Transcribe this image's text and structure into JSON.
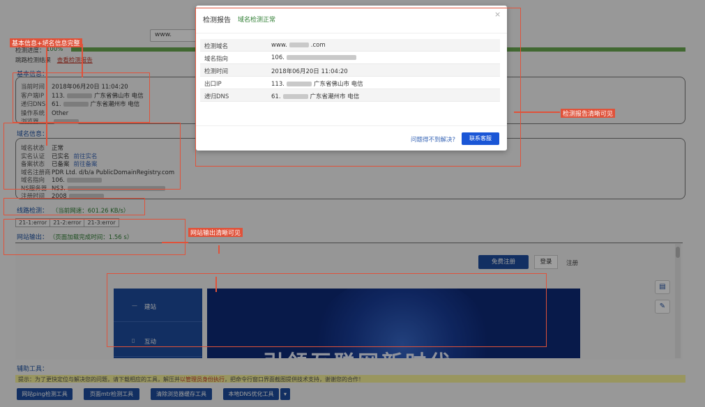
{
  "top_input": {
    "value": "www."
  },
  "progress": {
    "label": "检测进度：",
    "percent_text": "100%",
    "fraction": 1.0
  },
  "detect_result": {
    "label": "跳路检测结果",
    "link": "查看检测报告"
  },
  "basic_info": {
    "title": "基本信息：",
    "lines": [
      {
        "k": "当前时间",
        "v": "2018年06月20日 11:04:20",
        "extra": ""
      },
      {
        "k": "客户端IP",
        "v": "113.",
        "extra": "广东省佛山市 电信"
      },
      {
        "k": "递归DNS",
        "v": "61.",
        "extra": "广东省潮州市 电信"
      },
      {
        "k": "操作系统",
        "v": "Other",
        "extra": ""
      },
      {
        "k": "浏览器",
        "v": "",
        "extra": ""
      }
    ]
  },
  "domain_info": {
    "title": "域名信息：",
    "lines": [
      {
        "k": "域名状态",
        "v": "正常",
        "link": ""
      },
      {
        "k": "实名认证",
        "v": "已实名",
        "link": "前往实名"
      },
      {
        "k": "备案状态",
        "v": "已备案",
        "link": "前往备案"
      },
      {
        "k": "域名注册商",
        "v": "PDR Ltd. d/b/a PublicDomainRegistry.com",
        "link": ""
      },
      {
        "k": "域名指向",
        "v": "106.",
        "link": ""
      },
      {
        "k": "NS服务器",
        "v": "NS3.",
        "link": ""
      },
      {
        "k": "注册时间",
        "v": "2008",
        "link": ""
      }
    ]
  },
  "speed": {
    "title": "线路检测：",
    "sub": "（当前网速：601.26 KB/s）"
  },
  "errors": [
    "21-1:error",
    "21-2:error",
    "21-3:error"
  ],
  "site_output": {
    "title": "网站输出：",
    "sub": "（页面加载完成时间：1.56 s）"
  },
  "frame": {
    "btn_primary": "免费注册",
    "btn_secondary": "登录",
    "text": "注册",
    "side_items": [
      {
        "icon": "—",
        "label": "建站"
      },
      {
        "icon": "▯",
        "label": "互动"
      }
    ],
    "hero_text": "引领互联网新时代",
    "float_icons": [
      "chat-icon",
      "edit-icon"
    ]
  },
  "aux": {
    "title": "辅助工具：",
    "notice_a": "提示：为了更快定位与解决您的问题，请下载相应的工具，解压并",
    "notice_red": "以管理员身份执行",
    "notice_b": "，把命令行窗口界面截图提供技术支持，谢谢您的合作！",
    "buttons": [
      "网站ping检测工具",
      "页面mtr检测工具",
      "清除浏览器缓存工具",
      "本地DNS优化工具"
    ]
  },
  "modal": {
    "title": "检测报告",
    "subtitle": "域名检测正常",
    "close": "×",
    "rows": [
      {
        "k": "检测域名",
        "v": "www.",
        "v2": ".com"
      },
      {
        "k": "域名指向",
        "v": "106.",
        "v2": ""
      },
      {
        "k": "检测时间",
        "v": "2018年06月20日 11:04:20",
        "v2": ""
      },
      {
        "k": "出口IP",
        "v": "113.",
        "v2": "广东省佛山市 电信"
      },
      {
        "k": "递归DNS",
        "v": "61.",
        "v2": "广东省潮州市 电信"
      }
    ],
    "footer_link": "问题得不到解决?",
    "footer_button": "联系客服"
  },
  "annotations": {
    "a1": "基本信息+域名信息完整",
    "a2": "检测报告清晰可见",
    "a3": "网站输出清晰可见"
  },
  "colors": {
    "accent": "#1d4d9e",
    "annotation": "#e0523a",
    "ok": "#2e7d32"
  }
}
